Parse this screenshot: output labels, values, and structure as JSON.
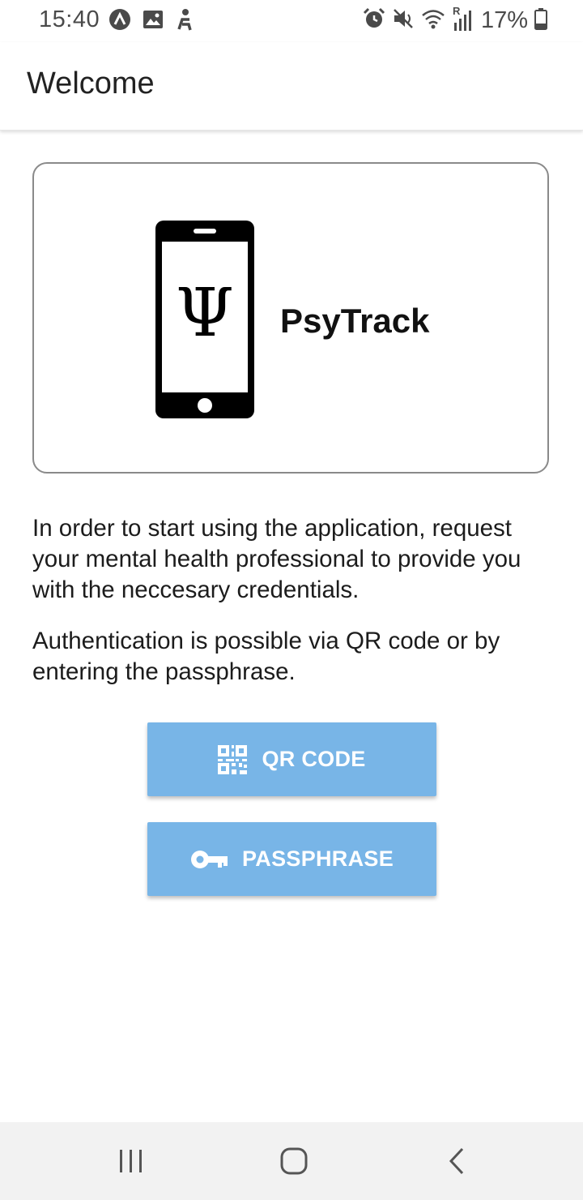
{
  "status_bar": {
    "time": "15:40",
    "left_icons": [
      "app-notification-icon",
      "gallery-icon",
      "accessibility-icon"
    ],
    "right_icons": [
      "alarm-icon",
      "mute-icon",
      "wifi-icon",
      "signal-icon",
      "battery-icon"
    ],
    "signal_label": "R",
    "battery": "17%"
  },
  "app_bar": {
    "title": "Welcome"
  },
  "logo": {
    "symbol": "Ψ",
    "app_name": "PsyTrack"
  },
  "content": {
    "paragraph_1": "In order to start using the application, request your mental health professional to provide you with the neccesary credentials.",
    "paragraph_2": "Authentication is possible via QR code or by entering the passphrase."
  },
  "buttons": {
    "qr_code": "QR CODE",
    "passphrase": "PASSPHRASE"
  },
  "colors": {
    "button": "#78b5e7",
    "nav_bar": "#f2f2f2"
  },
  "nav_bar": [
    "recent-apps-icon",
    "home-icon",
    "back-icon"
  ]
}
